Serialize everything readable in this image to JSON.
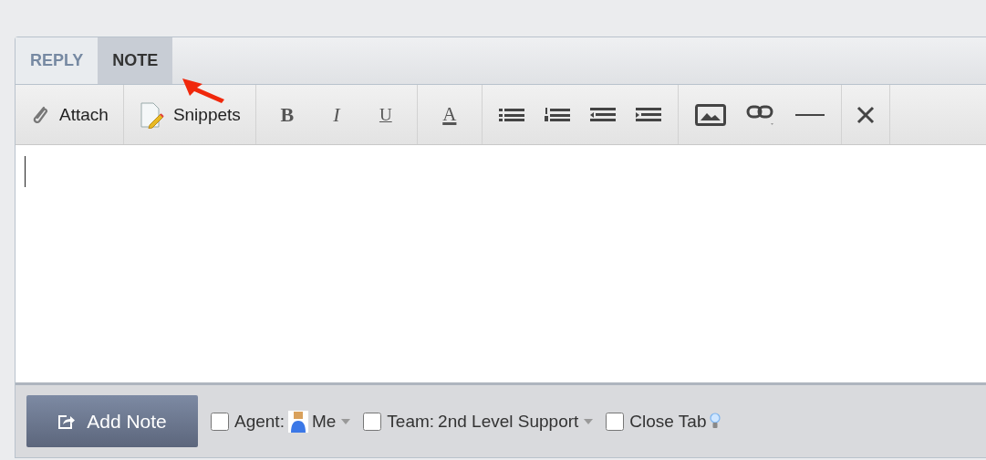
{
  "tabs": [
    {
      "label": "REPLY",
      "selected": false
    },
    {
      "label": "NOTE",
      "selected": true
    }
  ],
  "toolbar": {
    "attach": "Attach",
    "snippets": "Snippets",
    "format": [
      "B",
      "I",
      "U"
    ],
    "text_color": "A"
  },
  "footer": {
    "button": "Add Note",
    "options": [
      {
        "kind": "agent",
        "label": "Agent:",
        "value": "Me",
        "checked": false
      },
      {
        "kind": "team",
        "label": "Team:",
        "value": "2nd Level Support",
        "checked": false
      },
      {
        "kind": "close",
        "label": "Close Tab",
        "checked": false
      }
    ]
  }
}
